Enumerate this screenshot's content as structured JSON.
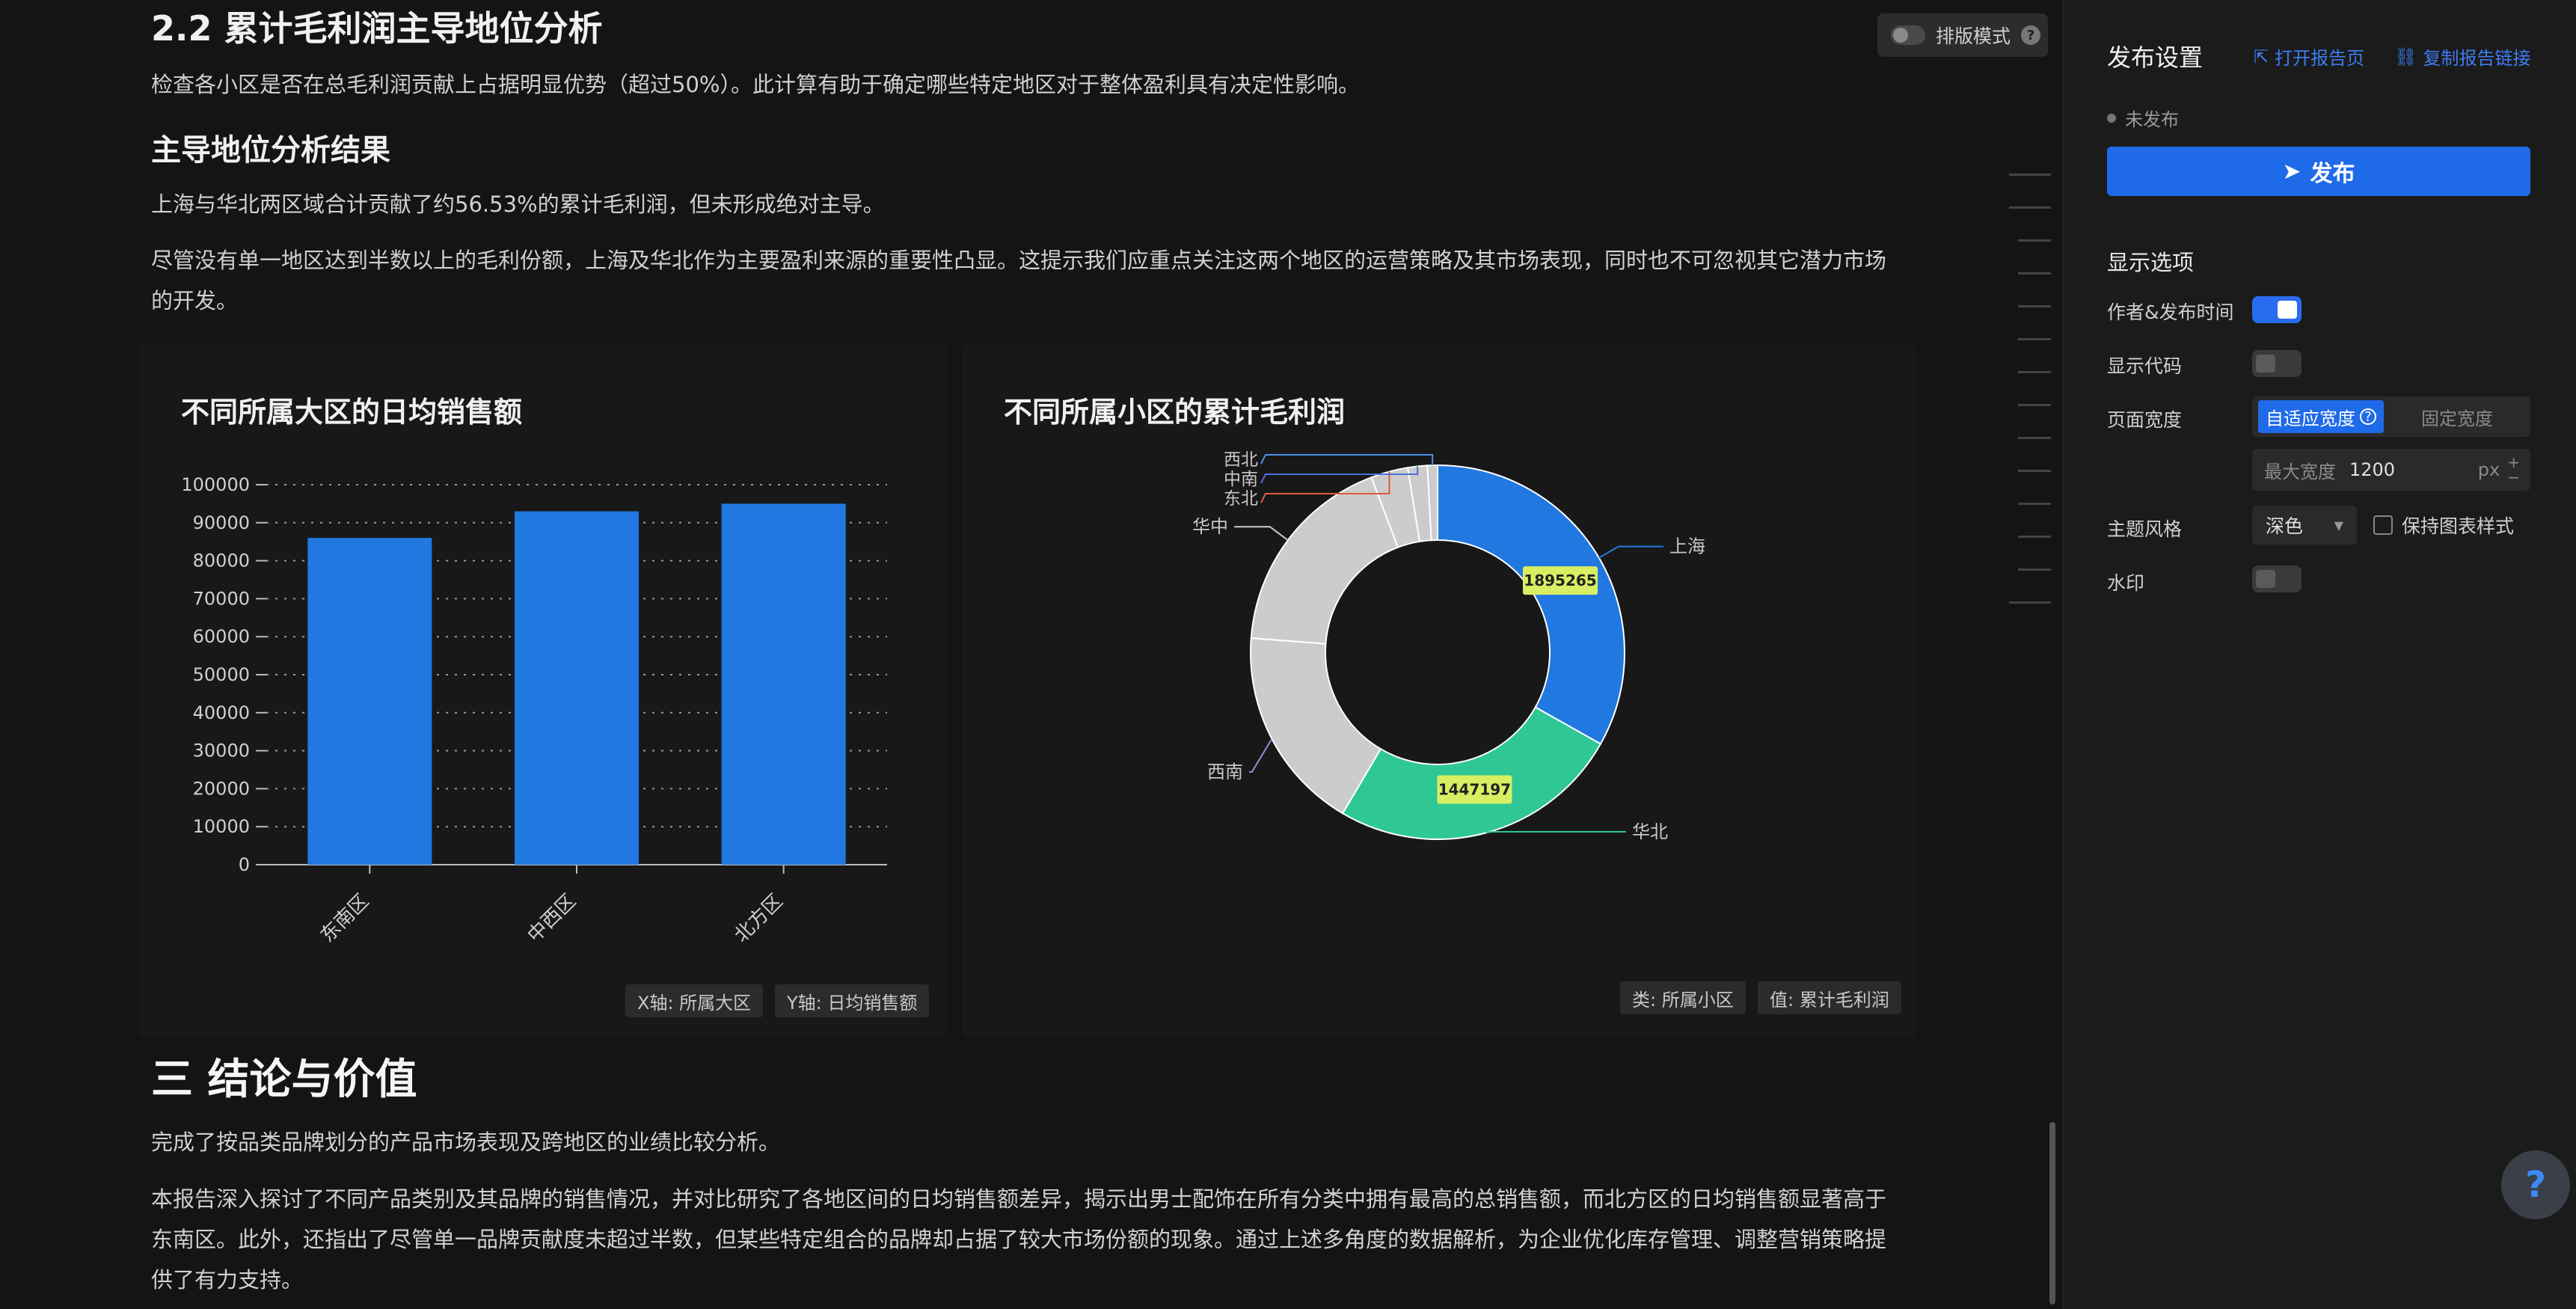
{
  "doc": {
    "section_title": "2.2 累计毛利润主导地位分析",
    "section_intro": "检查各小区是否在总毛利润贡献上占据明显优势（超过50%）。此计算有助于确定哪些特定地区对于整体盈利具有决定性影响。",
    "result_title": "主导地位分析结果",
    "result_p1": "上海与华北两区域合计贡献了约56.53%的累计毛利润，但未形成绝对主导。",
    "result_p2_line1": "尽管没有单一地区达到半数以上的毛利份额，上海及华北作为主要盈利来源的重要性凸显。这提示我们应重点关注这两个地区的运营策略及其市场表现，同时也不可忽视其它潜力市场",
    "result_p2_line2": "的开发。",
    "conclusion_title": "三 结论与价值",
    "conclusion_p1": "完成了按品类品牌划分的产品市场表现及跨地区的业绩比较分析。",
    "conclusion_p2_line1": "本报告深入探讨了不同产品类别及其品牌的销售情况，并对比研究了各地区间的日均销售额差异，揭示出男士配饰在所有分类中拥有最高的总销售额，而北方区的日均销售额显著高于",
    "conclusion_p2_line2": "东南区。此外，还指出了尽管单一品牌贡献度未超过半数，但某些特定组合的品牌却占据了较大市场份额的现象。通过上述多角度的数据解析，为企业优化库存管理、调整营销策略提",
    "conclusion_p2_line3": "供了有力支持。",
    "layout_mode_label": "排版模式"
  },
  "bar_chip_x": "X轴: 所属大区",
  "bar_chip_y": "Y轴: 日均销售额",
  "pie_chip_cat": "类: 所属小区",
  "pie_chip_val": "值: 累计毛利润",
  "chart_data": [
    {
      "type": "bar",
      "title": "不同所属大区的日均销售额",
      "categories": [
        "东南区",
        "中西区",
        "北方区"
      ],
      "values": [
        86000,
        93000,
        95000
      ],
      "ylim": [
        0,
        100000
      ],
      "yticks": [
        0,
        10000,
        20000,
        30000,
        40000,
        50000,
        60000,
        70000,
        80000,
        90000,
        100000
      ],
      "grid": true,
      "color": "#2178e0"
    },
    {
      "type": "pie",
      "title": "不同所属小区的累计毛利润",
      "donut": true,
      "labels": [
        "上海",
        "华北",
        "西南",
        "华中",
        "东北",
        "中南",
        "西北"
      ],
      "values": [
        1895265,
        1447197,
        1014000,
        1031000,
        183000,
        96000,
        50000
      ],
      "colors": [
        "#2178e0",
        "#2ec795",
        "#cccccc",
        "#cccccc",
        "#cccccc",
        "#cccccc",
        "#cccccc"
      ],
      "data_labels": [
        "1895265",
        "1447197"
      ]
    }
  ],
  "sidebar": {
    "title": "发布设置",
    "open_report": "打开报告页",
    "copy_link": "复制报告链接",
    "status": "未发布",
    "publish": "发布",
    "display_options": "显示选项",
    "author_time": "作者&发布时间",
    "show_code": "显示代码",
    "page_width": "页面宽度",
    "adaptive_width": "自适应宽度",
    "fixed_width": "固定宽度",
    "max_width_label": "最大宽度",
    "max_width_value": "1200",
    "max_width_unit": "px",
    "theme": "主题风格",
    "theme_value": "深色",
    "keep_chart_style": "保持图表样式",
    "watermark": "水印"
  },
  "help": "?"
}
